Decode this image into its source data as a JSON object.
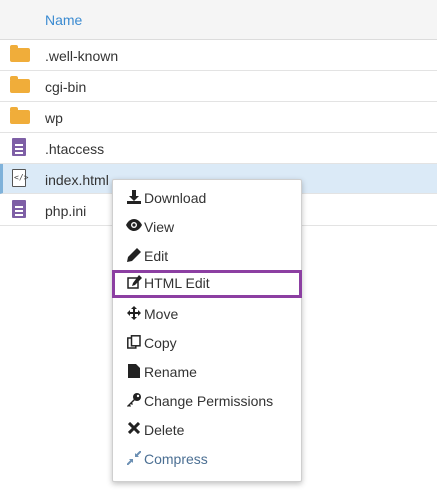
{
  "table": {
    "header": {
      "name_label": "Name"
    },
    "rows": [
      {
        "name": ".well-known",
        "icon": "folder-icon"
      },
      {
        "name": "cgi-bin",
        "icon": "folder-icon"
      },
      {
        "name": "wp",
        "icon": "folder-icon"
      },
      {
        "name": ".htaccess",
        "icon": "document-icon"
      },
      {
        "name": "index.html",
        "icon": "code-file-icon",
        "selected": true
      },
      {
        "name": "php.ini",
        "icon": "document-icon"
      }
    ]
  },
  "context_menu": {
    "items": [
      {
        "label": "Download",
        "icon": "download-icon"
      },
      {
        "label": "View",
        "icon": "eye-icon"
      },
      {
        "label": "Edit",
        "icon": "pencil-icon"
      },
      {
        "label": "HTML Edit",
        "icon": "edit-square-icon",
        "highlighted": true
      },
      {
        "label": "Move",
        "icon": "move-arrows-icon"
      },
      {
        "label": "Copy",
        "icon": "copy-icon"
      },
      {
        "label": "Rename",
        "icon": "file-icon"
      },
      {
        "label": "Change Permissions",
        "icon": "key-icon"
      },
      {
        "label": "Delete",
        "icon": "x-icon"
      },
      {
        "label": "Compress",
        "icon": "compress-icon",
        "muted": true
      }
    ]
  },
  "colors": {
    "header_text": "#3b8bd1",
    "folder": "#f0ad3a",
    "document": "#7e5fa6",
    "selected_row": "#dbeaf7",
    "highlight_border": "#8c3fa2"
  }
}
